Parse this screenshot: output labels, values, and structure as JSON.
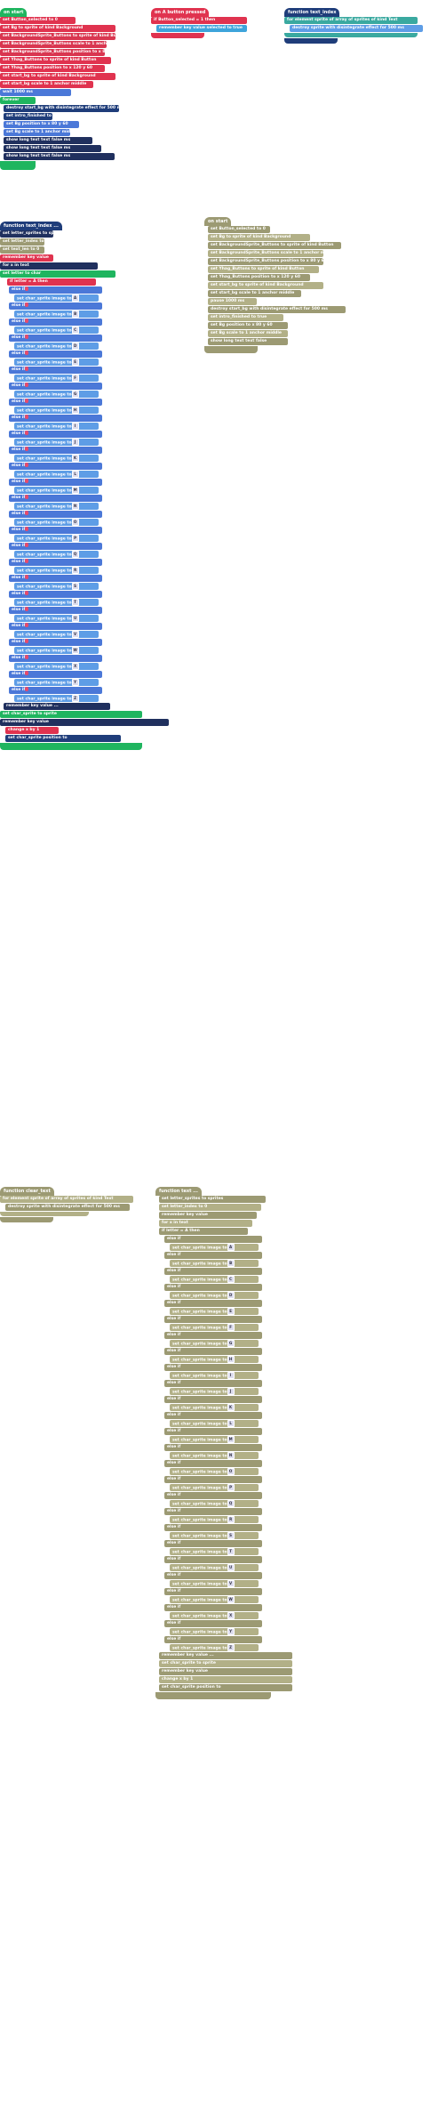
{
  "stack1": {
    "hat": "on start",
    "blocks": [
      "set  Button_selected  to  0",
      "set  Bg  to  sprite  of kind  Background",
      "set  BackgroundSprite_Buttons  to  sprite  of kind  Button",
      "set  BackgroundSprite_Buttons  scale  to  1  anchor  middle",
      "set  BackgroundSprite_Buttons  position  to  x  80  y  60",
      "set  Yhag_Buttons  to  sprite  of kind  Button",
      "set  Yhag_Buttons  position  to  x  120  y  60",
      "set  start_bg  to  sprite  of kind  Background",
      "set  start_bg  scale  to  1  anchor  middle",
      "wait  1000  ms",
      "forever",
      "destroy  start_bg  with  disintegrate  effect  for  500  ms",
      "set  intro_finished  to  true",
      "set  Bg  position  to  x  80  y  60",
      "set  Bg  scale  to  1  anchor  middle",
      "show  long text  text  false  ms",
      "show  long text  text  false  ms",
      "show  long text  text  false  ms"
    ]
  },
  "stack2": {
    "hat": "on  A  button  pressed",
    "blocks": [
      "if  Button_selected  =  1  then",
      "remember key value  selected  to  true"
    ]
  },
  "stack3": {
    "hat": "function  text_index",
    "blocks": [
      "for element  sprite  of  array of sprites of kind  Text",
      "destroy  sprite  with  disintegrate  effect for  500  ms"
    ]
  },
  "stack4": {
    "hat": "function  text_index  ...",
    "blocks": [
      "set  letter_sprites  to  sprites",
      "set  letter_index  to  0",
      "set  text_len  to  0",
      "remember key value",
      "for  x  in  text",
      "set  letter  to  char",
      "if  letter  =  A  then"
    ],
    "letters": [
      "A",
      "B",
      "C",
      "D",
      "E",
      "F",
      "G",
      "H",
      "I",
      "J",
      "K",
      "L",
      "M",
      "N",
      "O",
      "P",
      "Q",
      "R",
      "S",
      "T",
      "U",
      "V",
      "W",
      "X",
      "Y",
      "Z"
    ],
    "else_label": "else if",
    "set_label": "set  char_sprite  image  to",
    "then_label": "then",
    "tail": [
      "remember key value  ...",
      "set  char_sprite  to  sprite",
      "remember key value",
      "change  x  by  1",
      "set  char_sprite  position  to"
    ]
  },
  "stack5": {
    "hat": "on start",
    "blocks": [
      "set  Button_selected  to  0",
      "set  Bg  to  sprite  of kind  Background",
      "set  BackgroundSprite_Buttons  to  sprite  of kind  Button",
      "set  BackgroundSprite_Buttons  scale  to  1  anchor  middle",
      "set  BackgroundSprite_Buttons  position  to  x  80  y  60",
      "set  Yhag_Buttons  to  sprite  of kind  Button",
      "set  Yhag_Buttons  position  to  x  120  y  60",
      "set  start_bg  to  sprite  of kind  Background",
      "set  start_bg  scale  to  1  anchor  middle",
      "pause  1000  ms",
      "destroy  start_bg  with  disintegrate  effect for  500  ms",
      "set  intro_finished  to  true",
      "set  Bg  position  to  x  80  y  60",
      "set  Bg  scale  to  1  anchor  middle",
      "show long text  text  false"
    ]
  },
  "stack6": {
    "hat": "function  clear_text",
    "blocks": [
      "for element  sprite  of  array of sprites of kind  Text",
      "destroy  sprite  with  disintegrate  effect for  500  ms"
    ]
  },
  "stack7": {
    "hat": "function  text  ...",
    "blocks": [
      "set  letter_sprites  to  sprites",
      "set  letter_index  to  0",
      "remember key value",
      "for  x  in  text",
      "if  letter  =  A  then"
    ]
  }
}
